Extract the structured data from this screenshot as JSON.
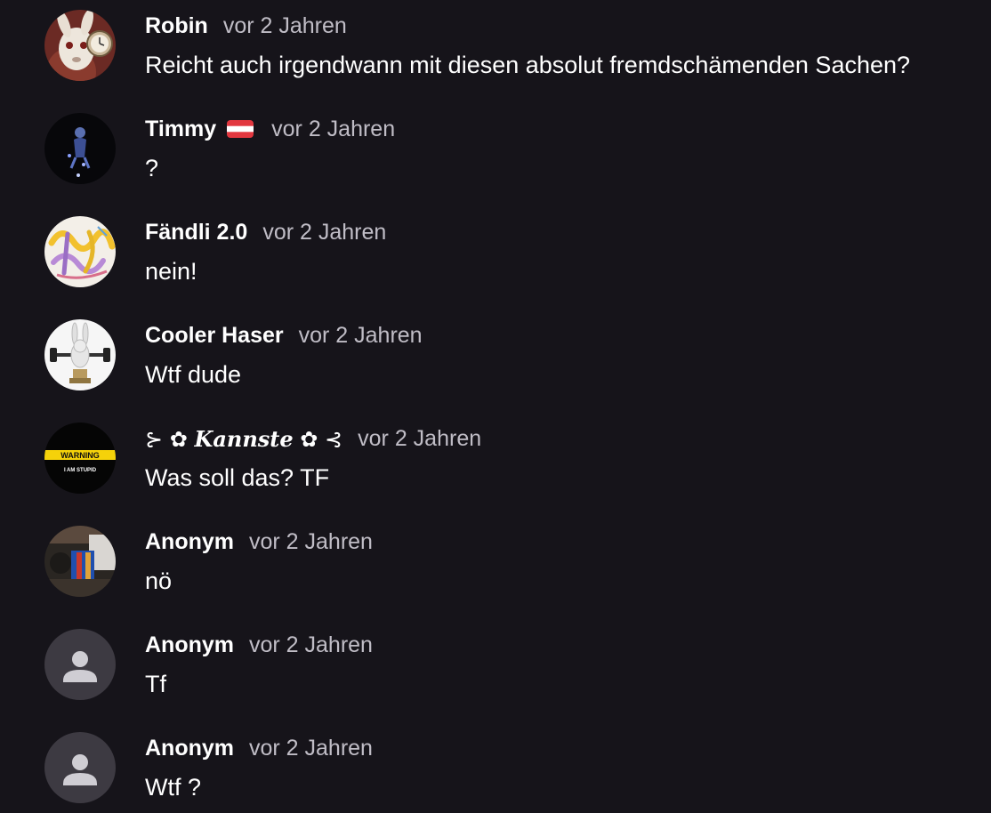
{
  "comments": [
    {
      "author": "Robin",
      "time": "vor 2 Jahren",
      "text": "Reicht auch irgendwann mit diesen absolut fremdschämenden Sachen?",
      "avatar_icon": "white-rabbit-clock-avatar"
    },
    {
      "author": "Timmy",
      "time": "vor 2 Jahren",
      "text": "?",
      "avatar_icon": "dark-figure-avatar",
      "flag": "austria-flag-icon"
    },
    {
      "author": "Fändli 2.0",
      "time": "vor 2 Jahren",
      "text": "nein!",
      "avatar_icon": "colorful-scribble-avatar"
    },
    {
      "author": "Cooler Haser",
      "time": "vor 2 Jahren",
      "text": "Wtf dude",
      "avatar_icon": "rabbid-weightlifting-avatar"
    },
    {
      "author": "Kannste",
      "author_prefix": "⊱ ✿ ",
      "author_suffix": " ✿ ⊰",
      "time": "vor 2 Jahren",
      "text": "Was soll das? TF",
      "avatar_icon": "warning-sign-avatar",
      "avatar_text_top": "WARNING",
      "avatar_text_bottom": "I AM STUPID"
    },
    {
      "author": "Anonym",
      "time": "vor 2 Jahren",
      "text": "nö",
      "avatar_icon": "photo-avatar"
    },
    {
      "author": "Anonym",
      "time": "vor 2 Jahren",
      "text": "Tf",
      "avatar_icon": "default-person-avatar"
    },
    {
      "author": "Anonym",
      "time": "vor 2 Jahren",
      "text": "Wtf ?",
      "avatar_icon": "default-person-avatar"
    }
  ],
  "colors": {
    "background": "#16141a",
    "author": "#ffffff",
    "time": "#c0bdc6",
    "text": "#ffffff",
    "default_avatar_bg": "#3d3a42",
    "default_avatar_fg": "#cfcdd3",
    "warning_yellow": "#f5d20a"
  }
}
